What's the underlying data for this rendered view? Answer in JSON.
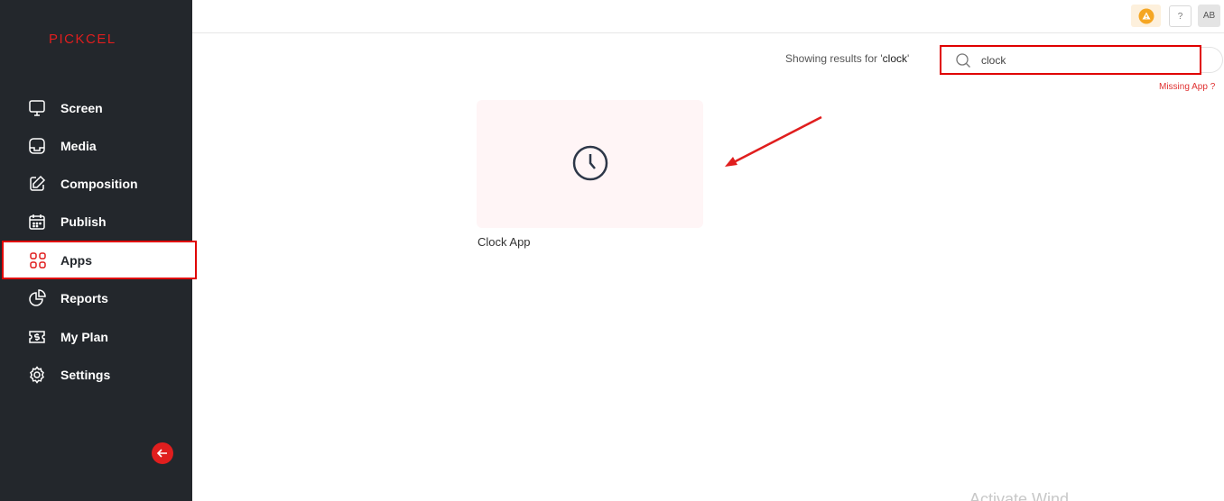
{
  "brand": {
    "logo_text": "PICKCEL"
  },
  "sidebar": {
    "items": [
      {
        "label": "Screen",
        "icon": "monitor-icon"
      },
      {
        "label": "Media",
        "icon": "media-folder-icon"
      },
      {
        "label": "Composition",
        "icon": "edit-icon"
      },
      {
        "label": "Publish",
        "icon": "calendar-icon"
      },
      {
        "label": "Apps",
        "icon": "apps-grid-icon",
        "active": true
      },
      {
        "label": "Reports",
        "icon": "pie-chart-icon"
      },
      {
        "label": "My Plan",
        "icon": "dollar-ticket-icon"
      },
      {
        "label": "Settings",
        "icon": "gear-icon"
      }
    ],
    "collapse_icon": "arrow-left-icon"
  },
  "topbar": {
    "alert_icon": "warning-icon",
    "help_label": "?",
    "avatar_initials": "AB"
  },
  "search": {
    "results_prefix": "Showing results for '",
    "query_shown": "clock",
    "results_suffix": "'",
    "value": "clock",
    "missing_app_label": "Missing App ?"
  },
  "results": [
    {
      "name": "Clock App",
      "icon": "clock-icon"
    }
  ],
  "colors": {
    "sidebar_bg": "#23272c",
    "accent_red": "#e00000",
    "card_bg": "#fff5f6",
    "warning": "#f5a623"
  },
  "watermark": "Activate Wind"
}
